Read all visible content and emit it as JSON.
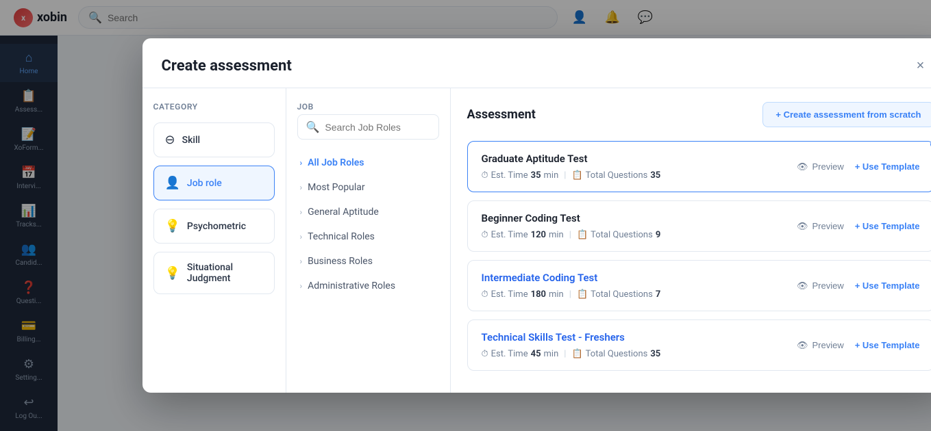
{
  "app": {
    "name": "xobin",
    "search_placeholder": "Search"
  },
  "topnav": {
    "icons": [
      "user",
      "bell",
      "chat"
    ]
  },
  "sidebar": {
    "items": [
      {
        "id": "home",
        "label": "Home",
        "icon": "⌂",
        "active": true
      },
      {
        "id": "assessments",
        "label": "Assess...",
        "icon": "📋",
        "active": false
      },
      {
        "id": "xoform",
        "label": "XoForm...",
        "icon": "📝",
        "active": false
      },
      {
        "id": "interviews",
        "label": "Intervi...",
        "icon": "📅",
        "active": false
      },
      {
        "id": "tracking",
        "label": "Tracks...",
        "icon": "📊",
        "active": false
      },
      {
        "id": "candidates",
        "label": "Candid...",
        "icon": "👤",
        "active": false
      },
      {
        "id": "questions",
        "label": "Questi...",
        "icon": "❓",
        "active": false
      },
      {
        "id": "billing",
        "label": "Billing...",
        "icon": "💳",
        "active": false
      },
      {
        "id": "settings",
        "label": "Setting...",
        "icon": "⚙",
        "active": false
      },
      {
        "id": "logout",
        "label": "Log Ou...",
        "icon": "↩",
        "active": false
      }
    ]
  },
  "modal": {
    "title": "Create assessment",
    "close_label": "×",
    "category_label": "Category",
    "job_label": "Job",
    "assessment_label": "Assessment",
    "create_scratch_label": "+ Create assessment from scratch",
    "search_placeholder": "Search Job Roles",
    "categories": [
      {
        "id": "skill",
        "label": "Skill",
        "icon": "⊖",
        "active": false
      },
      {
        "id": "job-role",
        "label": "Job role",
        "icon": "👤",
        "active": true
      },
      {
        "id": "psychometric",
        "label": "Psychometric",
        "icon": "💡",
        "active": false
      },
      {
        "id": "situational-judgment",
        "label": "Situational Judgment",
        "icon": "💡",
        "active": false
      }
    ],
    "job_roles": [
      {
        "id": "all",
        "label": "All Job Roles",
        "active": true
      },
      {
        "id": "most-popular",
        "label": "Most Popular",
        "active": false
      },
      {
        "id": "general-aptitude",
        "label": "General Aptitude",
        "active": false
      },
      {
        "id": "technical-roles",
        "label": "Technical Roles",
        "active": false
      },
      {
        "id": "business-roles",
        "label": "Business Roles",
        "active": false
      },
      {
        "id": "administrative-roles",
        "label": "Administrative Roles",
        "active": false
      }
    ],
    "assessments": [
      {
        "id": "graduate-aptitude",
        "name": "Graduate Aptitude Test",
        "name_color": "normal",
        "est_time": "35",
        "total_questions": "35",
        "highlighted": true
      },
      {
        "id": "beginner-coding",
        "name": "Beginner Coding Test",
        "name_color": "normal",
        "est_time": "120",
        "total_questions": "9",
        "highlighted": false
      },
      {
        "id": "intermediate-coding",
        "name": "Intermediate Coding Test",
        "name_color": "blue",
        "est_time": "180",
        "total_questions": "7",
        "highlighted": false
      },
      {
        "id": "technical-skills-freshers",
        "name": "Technical Skills Test - Freshers",
        "name_color": "blue",
        "est_time": "45",
        "total_questions": "35",
        "highlighted": false
      }
    ],
    "labels": {
      "est_time": "Est. Time",
      "total_questions": "Total Questions",
      "min": "min",
      "preview": "Preview",
      "use_template": "+ Use Template"
    }
  }
}
